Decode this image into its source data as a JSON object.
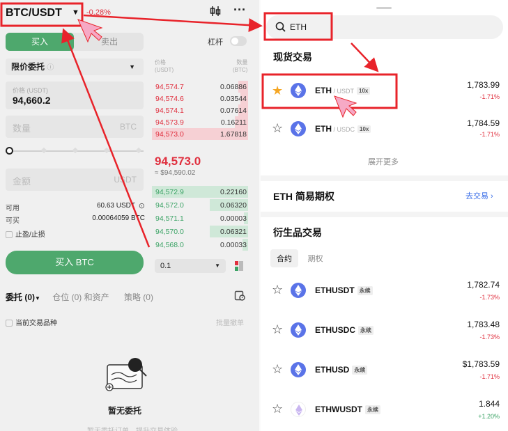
{
  "left": {
    "pair": "BTC/USDT",
    "change": "-0.28%",
    "tabs": {
      "buy": "买入",
      "sell": "卖出"
    },
    "leverage_label": "杠杆",
    "order_type": "限价委托",
    "price_field": {
      "label": "价格 (USDT)",
      "value": "94,660.2"
    },
    "amount_field": {
      "placeholder": "数量",
      "unit": "BTC"
    },
    "total_field": {
      "placeholder": "金额",
      "unit": "USDT"
    },
    "available": {
      "label": "可用",
      "value": "60.63 USDT"
    },
    "can_buy": {
      "label": "可买",
      "value": "0.00064059 BTC"
    },
    "tpsl_label": "止盈/止损",
    "buy_button": "买入 BTC",
    "orderbook": {
      "price_header": [
        "价格",
        "(USDT)"
      ],
      "qty_header": [
        "数量",
        "(BTC)"
      ],
      "asks": [
        {
          "price": "94,574.7",
          "qty": "0.06886",
          "depth": 0.1
        },
        {
          "price": "94,574.6",
          "qty": "0.03544",
          "depth": 0.08
        },
        {
          "price": "94,574.1",
          "qty": "0.07614",
          "depth": 0.1
        },
        {
          "price": "94,573.9",
          "qty": "0.16211",
          "depth": 0.14
        },
        {
          "price": "94,573.0",
          "qty": "1.67818",
          "depth": 1.0
        }
      ],
      "last_price": "94,573.0",
      "last_fiat": "≈ $94,590.02",
      "bids": [
        {
          "price": "94,572.9",
          "qty": "0.22160",
          "depth": 1.0
        },
        {
          "price": "94,572.0",
          "qty": "0.06320",
          "depth": 0.4
        },
        {
          "price": "94,571.1",
          "qty": "0.00003",
          "depth": 0.04
        },
        {
          "price": "94,570.0",
          "qty": "0.06321",
          "depth": 0.4
        },
        {
          "price": "94,568.0",
          "qty": "0.00033",
          "depth": 0.06
        }
      ],
      "depth_value": "0.1"
    },
    "bottom_tabs": {
      "orders": "委托 (0)",
      "positions": "仓位 (0) 和资产",
      "strategy": "策略 (0)"
    },
    "current_only": "当前交易品种",
    "batch_cancel": "批量撤单",
    "empty_title": "暂无委托",
    "empty_sub": "暂无委托订单，提升交易体验"
  },
  "right": {
    "search_value": "ETH",
    "spot_title": "现货交易",
    "spot_rows": [
      {
        "base": "ETH",
        "quote": " / USDT",
        "badge": "10x",
        "price": "1,783.99",
        "change": "-1.71%",
        "starred": true
      },
      {
        "base": "ETH",
        "quote": " / USDC",
        "badge": "10x",
        "price": "1,784.59",
        "change": "-1.71%",
        "starred": false
      }
    ],
    "expand_more": "展开更多",
    "options_title": "ETH 简易期权",
    "options_link": "去交易 ›",
    "deriv_title": "衍生品交易",
    "deriv_tabs": {
      "contract": "合约",
      "options": "期权"
    },
    "deriv_rows": [
      {
        "sym": "ETHUSDT",
        "badge": "永续",
        "price": "1,782.74",
        "change": "-1.73%"
      },
      {
        "sym": "ETHUSDC",
        "badge": "永续",
        "price": "1,783.48",
        "change": "-1.73%"
      },
      {
        "sym": "ETHUSD",
        "badge": "永续",
        "price": "$1,783.59",
        "change": "-1.71%"
      },
      {
        "sym": "ETHWUSDT",
        "badge": "永续",
        "price": "1.844",
        "change": "+1.20%"
      }
    ]
  },
  "colors": {
    "buy_green": "#4ea86d",
    "ask_red": "#e0303f",
    "highlight_red": "#e8232a",
    "link_blue": "#3a6ee8"
  }
}
